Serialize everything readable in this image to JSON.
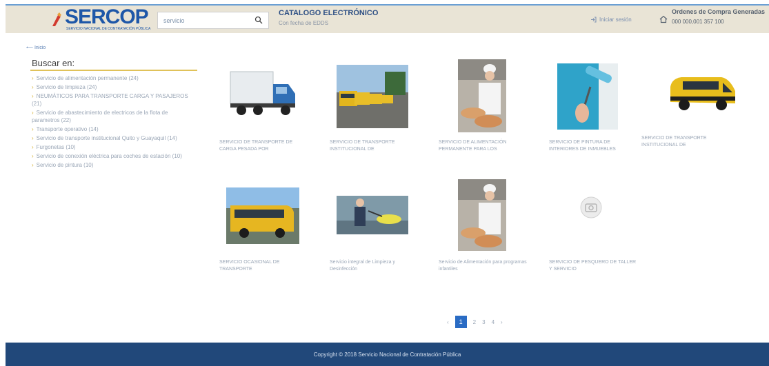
{
  "header": {
    "logo_text": "SERCOP",
    "logo_subtext": "SERVICIO NACIONAL DE CONTRATACIÓN PÚBLICA",
    "search_value": "servicio",
    "catalog_title": "CATALOGO ELECTRÓNICO",
    "catalog_subtitle": "Con fecha de EDDS",
    "login_label": "Iniciar sesión",
    "orders_title": "Ordenes de Compra Generadas",
    "orders_count": "000 000,001 357 100"
  },
  "sidebar": {
    "back_label": "Inicio",
    "title": "Buscar en:",
    "categories": [
      "Servicio de alimentación permanente (24)",
      "Servicio de limpieza (24)",
      "NEUMÁTICOS PARA TRANSPORTE CARGA Y PASAJEROS (21)",
      "Servicio de abastecimiento de electricos de la flota de parametros (22)",
      "Transporte operativo (14)",
      "Servicio de transporte institucional Quito y Guayaquil (14)",
      "Furgonetas (10)",
      "Servicio de conexión eléctrica para coches de estación (10)",
      "Servicio de pintura (10)"
    ]
  },
  "products": [
    {
      "caption": "SERVICIO DE TRANSPORTE DE CARGA PESADA POR"
    },
    {
      "caption": "SERVICIO DE TRANSPORTE INSTITUCIONAL DE"
    },
    {
      "caption": "SERVICIO DE ALIMENTACIÓN PERMANENTE PARA LOS"
    },
    {
      "caption": "SERVICIO DE PINTURA DE INTERIORES DE INMUEBLES"
    },
    {
      "caption": "SERVICIO DE TRANSPORTE INSTITUCIONAL DE"
    },
    {
      "caption": "SERVICIO OCASIONAL DE TRANSPORTE"
    },
    {
      "caption": "Servicio integral de Limpieza y Desinfección"
    },
    {
      "caption": "Servicio de Alimentación para programas infantiles"
    },
    {
      "caption": "SERVICIO DE PESQUERO DE TALLER Y SERVICIO"
    }
  ],
  "pagination": {
    "prev": "‹",
    "pages": [
      "1",
      "2",
      "3",
      "4"
    ],
    "next": "›",
    "active": "1"
  },
  "footer": {
    "copyright": "Copyright © 2018 Servicio Nacional de Contratación Pública"
  },
  "colors": {
    "header_bg": "#e9e4d6",
    "brand_blue": "#1e57a8",
    "footer_bg": "#21487a",
    "accent_gold": "#e0c25a",
    "pager_active": "#2a6cc4"
  }
}
